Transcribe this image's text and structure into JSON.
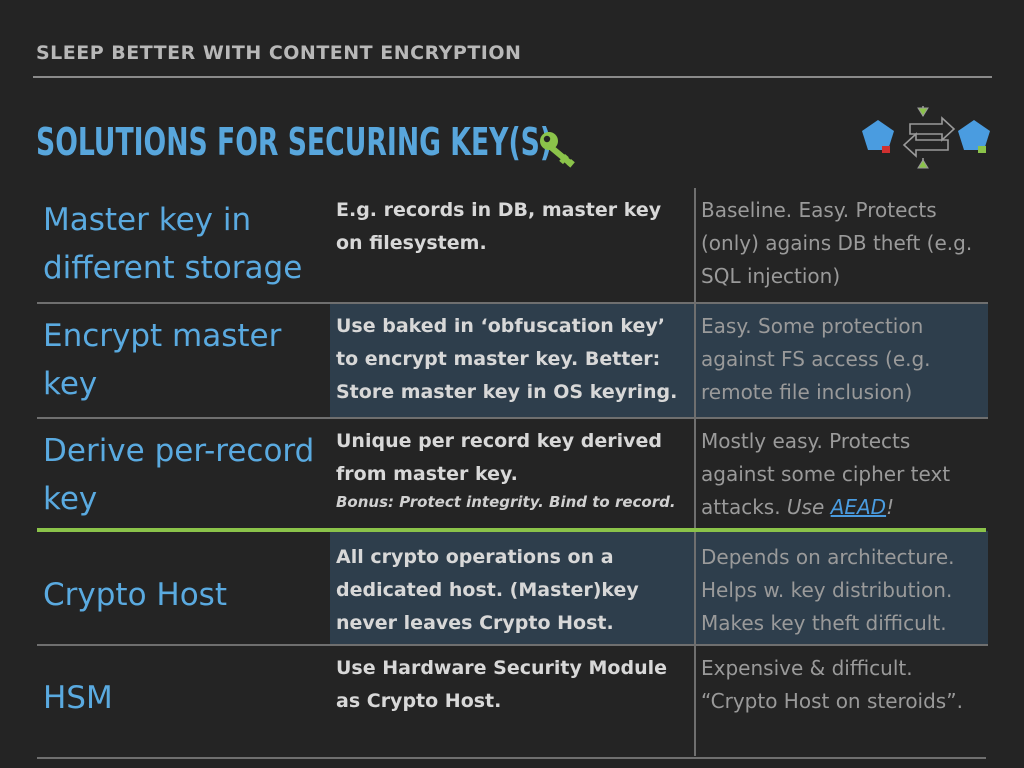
{
  "header": {
    "text": "SLEEP BETTER WITH CONTENT ENCRYPTION"
  },
  "title": {
    "text": "SOLUTIONS FOR SECURING KEY(S)"
  },
  "colors": {
    "title": "#58a6dc",
    "accent_line": "#8bc34a",
    "highlight_bg": "#2e3e4c",
    "key_icon": "#8bc34a"
  },
  "icons": {
    "title_icon": "key-icon",
    "diagram": "key-exchange-diagram-icon"
  },
  "rows": [
    {
      "name": "Master key in different storage",
      "desc": "E.g. records in DB, master key on filesystem.",
      "eval": "Baseline. Easy. Protects (only) agains DB theft (e.g. SQL injection)"
    },
    {
      "name": "Encrypt master key",
      "desc": "Use baked in ‘obfuscation key’ to encrypt master key. Better: Store master key in OS keyring.",
      "eval": "Easy. Some protection against FS access (e.g. remote file inclusion)"
    },
    {
      "name": "Derive per-record key",
      "desc": "Unique per record key derived from master key.",
      "bonus": "Bonus: Protect integrity. Bind to record.",
      "eval_pre": "Mostly easy. Protects against some cipher text attacks. ",
      "eval_italic": "Use ",
      "eval_link": "AEAD",
      "eval_post": "!"
    },
    {
      "name": "Crypto Host",
      "desc": "All crypto operations on a dedicated host. (Master)key never leaves Crypto Host.",
      "eval": "Depends on architecture. Helps w. key distribution. Makes key theft difficult."
    },
    {
      "name": "HSM",
      "desc": "Use Hardware Security Module as Crypto Host.",
      "eval": "Expensive & difficult. “Crypto Host on steroids”."
    }
  ]
}
